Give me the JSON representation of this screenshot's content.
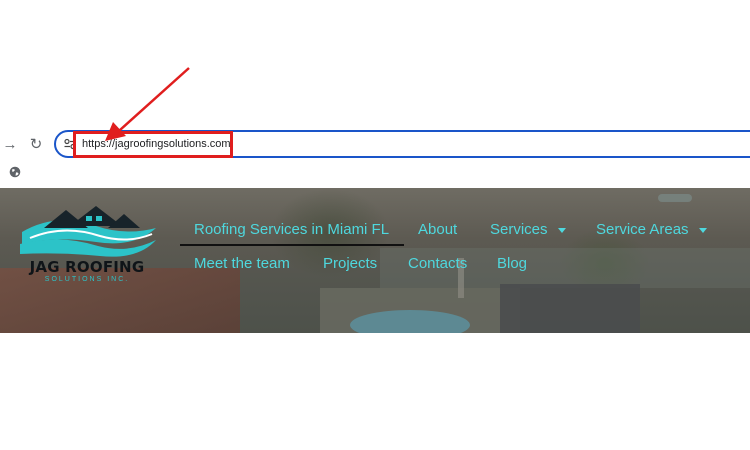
{
  "browser": {
    "url": "https://jagroofingsolutions.com",
    "forward_icon": "forward-arrow-icon",
    "reload_icon": "reload-icon",
    "site_info_icon": "tune-icon",
    "globe_icon": "globe-icon",
    "accent_color": "#1a55c9"
  },
  "annotation": {
    "color": "#e01e1e"
  },
  "site": {
    "logo": {
      "title": "JAG ROOFING",
      "subtitle": "SOLUTIONS INC."
    },
    "menu": {
      "active": "Roofing Services in Miami FL",
      "about": "About",
      "services": "Services",
      "service_areas": "Service Areas",
      "team": "Meet the team",
      "projects": "Projects",
      "contacts": "Contacts",
      "blog": "Blog"
    },
    "menu_color": "#4ed8de"
  }
}
